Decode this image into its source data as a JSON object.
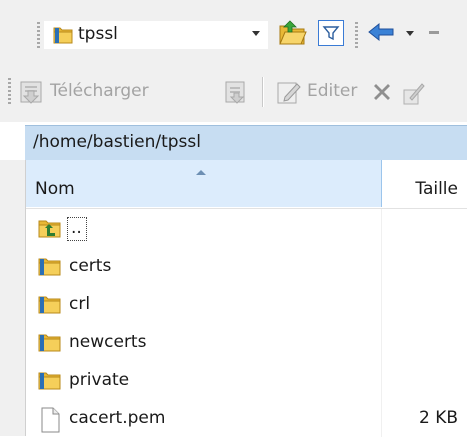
{
  "toolbar_top": {
    "folder_combo_value": "tpssl",
    "icons": [
      "folder-icon",
      "combo-dropdown-icon",
      "open-folder-icon",
      "filter-icon",
      "back-arrow-icon"
    ]
  },
  "toolbar_actions": {
    "download_label": "Télécharger",
    "edit_label": "Editer",
    "icons": [
      "download-icon",
      "download-options-icon",
      "edit-icon",
      "delete-icon"
    ]
  },
  "path_bar": {
    "path": "/home/bastien/tpssl"
  },
  "file_list": {
    "columns": {
      "name": "Nom",
      "size": "Taille"
    },
    "sort": "Nom ascending",
    "rows": [
      {
        "name": "..",
        "size": "",
        "icon": "parent-folder-icon"
      },
      {
        "name": "certs",
        "size": "",
        "icon": "folder-icon"
      },
      {
        "name": "crl",
        "size": "",
        "icon": "folder-icon"
      },
      {
        "name": "newcerts",
        "size": "",
        "icon": "folder-icon"
      },
      {
        "name": "private",
        "size": "",
        "icon": "folder-icon"
      },
      {
        "name": "cacert.pem",
        "size": "2 KB",
        "icon": "file-icon"
      }
    ]
  },
  "colors": {
    "toolbar_bg": "#f0f0f0",
    "path_bar_bg": "#c7ddf2",
    "sorted_column_bg": "#dcecfc",
    "folder_yellow": "#e8b836"
  }
}
